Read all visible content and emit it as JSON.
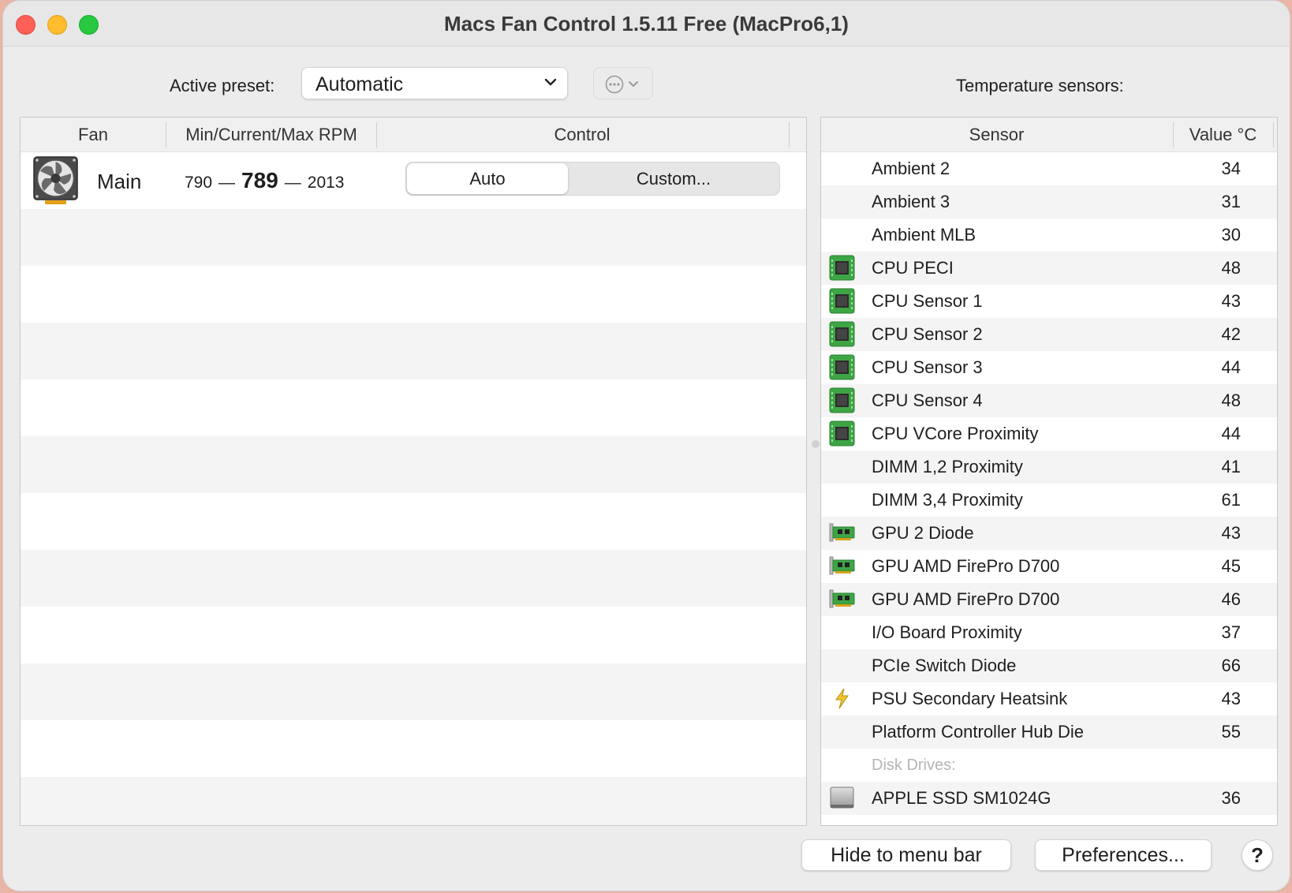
{
  "window": {
    "title": "Macs Fan Control 1.5.11 Free (MacPro6,1)"
  },
  "toolbar": {
    "active_preset_label": "Active preset:",
    "active_preset_value": "Automatic",
    "temperature_sensors_label": "Temperature sensors:"
  },
  "fan_table": {
    "columns": [
      "Fan",
      "Min/Current/Max RPM",
      "Control"
    ],
    "rows": [
      {
        "name": "Main",
        "min_rpm": "790",
        "current_rpm": "789",
        "max_rpm": "2013",
        "control_options": [
          "Auto",
          "Custom..."
        ],
        "selected_control": "Auto"
      }
    ]
  },
  "sensor_table": {
    "columns": [
      "Sensor",
      "Value °C"
    ],
    "rows": [
      {
        "name": "Ambient 2",
        "value": "34",
        "icon": "none"
      },
      {
        "name": "Ambient 3",
        "value": "31",
        "icon": "none"
      },
      {
        "name": "Ambient MLB",
        "value": "30",
        "icon": "none"
      },
      {
        "name": "CPU PECI",
        "value": "48",
        "icon": "cpu-chip-icon"
      },
      {
        "name": "CPU Sensor 1",
        "value": "43",
        "icon": "cpu-chip-icon"
      },
      {
        "name": "CPU Sensor 2",
        "value": "42",
        "icon": "cpu-chip-icon"
      },
      {
        "name": "CPU Sensor 3",
        "value": "44",
        "icon": "cpu-chip-icon"
      },
      {
        "name": "CPU Sensor 4",
        "value": "48",
        "icon": "cpu-chip-icon"
      },
      {
        "name": "CPU VCore Proximity",
        "value": "44",
        "icon": "cpu-chip-icon"
      },
      {
        "name": "DIMM 1,2 Proximity",
        "value": "41",
        "icon": "none"
      },
      {
        "name": "DIMM 3,4 Proximity",
        "value": "61",
        "icon": "none"
      },
      {
        "name": "GPU 2 Diode",
        "value": "43",
        "icon": "gpu-card-icon"
      },
      {
        "name": "GPU AMD FirePro D700",
        "value": "45",
        "icon": "gpu-card-icon"
      },
      {
        "name": "GPU AMD FirePro D700",
        "value": "46",
        "icon": "gpu-card-icon"
      },
      {
        "name": "I/O Board Proximity",
        "value": "37",
        "icon": "none"
      },
      {
        "name": "PCIe Switch Diode",
        "value": "66",
        "icon": "none"
      },
      {
        "name": "PSU Secondary Heatsink",
        "value": "43",
        "icon": "lightning-bolt-icon"
      },
      {
        "name": "Platform Controller Hub Die",
        "value": "55",
        "icon": "none"
      },
      {
        "name": "Disk Drives:",
        "value": "",
        "icon": "none",
        "section_header": true
      },
      {
        "name": "APPLE SSD SM1024G",
        "value": "36",
        "icon": "ssd-drive-icon"
      }
    ]
  },
  "footer": {
    "hide_button": "Hide to menu bar",
    "preferences_button": "Preferences...",
    "help_button": "?"
  },
  "colors": {
    "window_bg": "#ececec",
    "close": "#fe5f57",
    "minimize": "#febc2e",
    "maximize": "#28c840",
    "cpu_chip_green": "#3ea545"
  }
}
